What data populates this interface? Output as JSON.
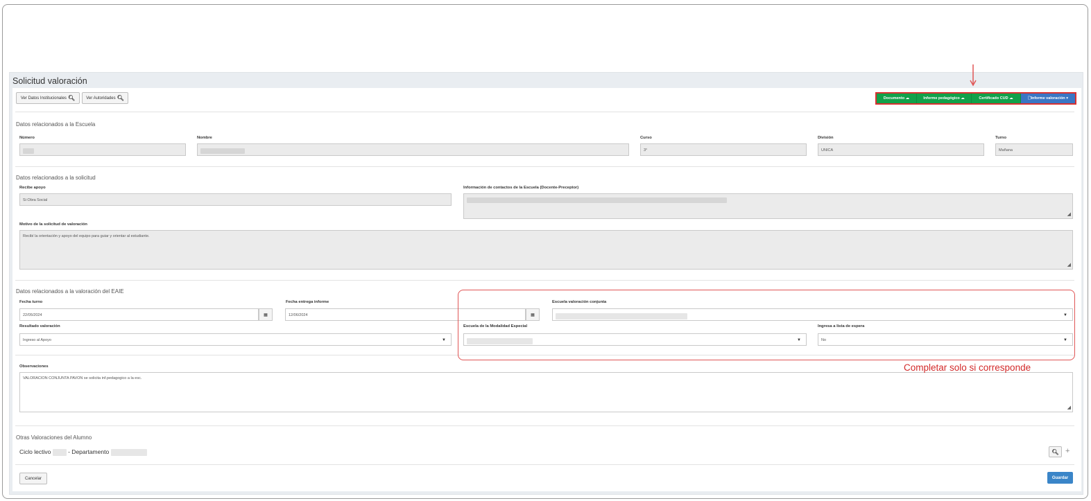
{
  "page": {
    "title": "Solicitud valoración"
  },
  "toolbar": {
    "datos_institucionales": "Ver Datos Institucionales",
    "autoridades": "Ver Autoridades",
    "documento": "Documento",
    "informe_pedagogico": "Informe pedagógico",
    "certificado_cud": "Certificado CUD",
    "informe_valoracion": "Informe valoración"
  },
  "escuela": {
    "title": "Datos relacionados a la Escuela",
    "numero_label": "Número",
    "nombre_label": "Nombre",
    "curso_label": "Curso",
    "curso_value": "3°",
    "division_label": "División",
    "division_value": "UNICA",
    "turno_label": "Turno",
    "turno_value": "Mañana"
  },
  "solicitud": {
    "title": "Datos relacionados a la solicitud",
    "apoyo_label": "Recibe apoyo",
    "apoyo_value": "Si Obra Social",
    "contactos_label": "Información de contactos de la Escuela (Docente-Preceptor)",
    "motivo_label": "Motivo de la solicitud de valoración",
    "motivo_value": "Recibí la orientación y apoyo del equipo para guiar y orientar al estudiante."
  },
  "valoracion": {
    "title": "Datos relacionados a la valoración del EAIE",
    "fecha_turno_label": "Fecha turno",
    "fecha_turno_value": "22/05/2024",
    "fecha_entrega_label": "Fecha entrega informe",
    "fecha_entrega_value": "12/06/2024",
    "escuela_conjunta_label": "Escuela valoración conjunta",
    "resultado_label": "Resultado valoración",
    "resultado_value": "Ingreso al Apoyo",
    "modalidad_label": "Escuela de la Modalidad Especial",
    "espera_label": "Ingresa a lista de espera",
    "espera_value": "No",
    "observaciones_label": "Observaciones",
    "observaciones_value": "VALORACION CONJUNTA PAVON se solicita inf.pedagogico a la esc."
  },
  "otras": {
    "title": "Otras Valoraciones del Alumno",
    "ciclo_label": "Ciclo lectivo",
    "departamento_label": "- Departamento"
  },
  "footer": {
    "cancelar": "Cancelar",
    "guardar": "Guardar"
  },
  "annotation": {
    "text": "Completar solo si corresponde"
  },
  "colors": {
    "highlight": "#e05555",
    "green": "#12a14a",
    "blue": "#3a76c4"
  }
}
